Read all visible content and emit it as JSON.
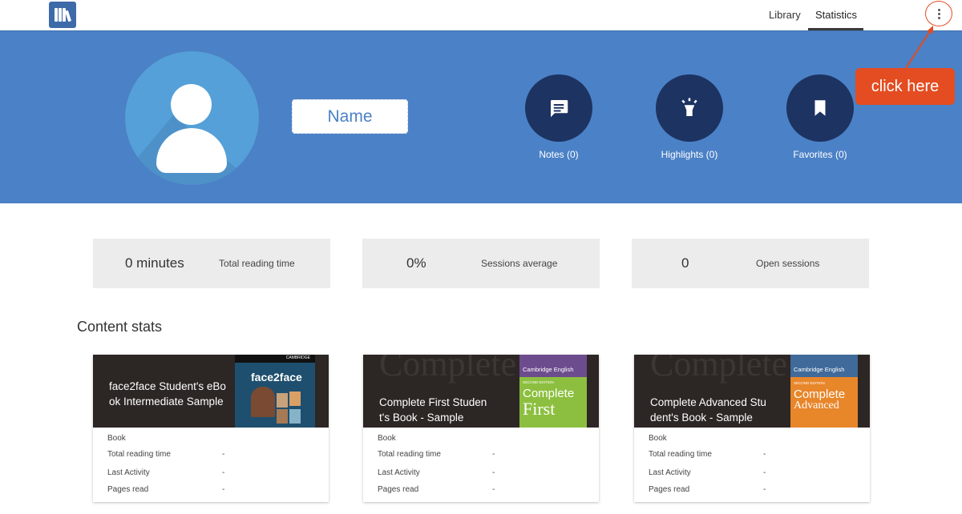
{
  "nav": {
    "library": "Library",
    "statistics": "Statistics"
  },
  "profile": {
    "name": "Name"
  },
  "stats": {
    "notes": "Notes (0)",
    "highlights": "Highlights (0)",
    "favorites": "Favorites (0)"
  },
  "callout": {
    "text": "click here"
  },
  "summary": [
    {
      "value": "0 minutes",
      "label": "Total reading time"
    },
    {
      "value": "0%",
      "label": "Sessions average"
    },
    {
      "value": "0",
      "label": "Open sessions"
    }
  ],
  "content_stats_title": "Content stats",
  "books": [
    {
      "title": "face2face Student's eBook Intermediate Sample",
      "type": "Book",
      "labels": {
        "reading_time": "Total reading time",
        "last_activity": "Last Activity",
        "pages_read": "Pages read"
      },
      "values": {
        "reading_time": "-",
        "last_activity": "-",
        "pages_read": "-"
      },
      "cover": {
        "publisher": "CAMBRIDGE",
        "brand": "face2face"
      }
    },
    {
      "title": "Complete First Student's Book - Sample",
      "type": "Book",
      "labels": {
        "reading_time": "Total reading time",
        "last_activity": "Last Activity",
        "pages_read": "Pages read"
      },
      "values": {
        "reading_time": "-",
        "last_activity": "-",
        "pages_read": "-"
      },
      "cover": {
        "publisher": "Cambridge English",
        "edition": "SECOND EDITION",
        "line1": "Complete",
        "line2": "First",
        "ghost": "Complete"
      }
    },
    {
      "title": "Complete Advanced Student's Book - Sample",
      "type": "Book",
      "labels": {
        "reading_time": "Total reading time",
        "last_activity": "Last Activity",
        "pages_read": "Pages read"
      },
      "values": {
        "reading_time": "-",
        "last_activity": "-",
        "pages_read": "-"
      },
      "cover": {
        "publisher": "Cambridge English",
        "edition": "SECOND EDITION",
        "line1": "Complete",
        "line2": "Advanced",
        "ghost": "Complete"
      }
    }
  ],
  "colors": {
    "banner": "#4b81c6",
    "stat_circle": "#1d3361",
    "callout": "#e44c21",
    "card_bg": "#ececec"
  },
  "icons": {
    "logo": "library-logo-icon",
    "menu": "more-vertical-icon",
    "notes": "note-icon",
    "highlights": "highlighter-icon",
    "favorites": "bookmark-icon",
    "avatar": "user-avatar-icon"
  }
}
